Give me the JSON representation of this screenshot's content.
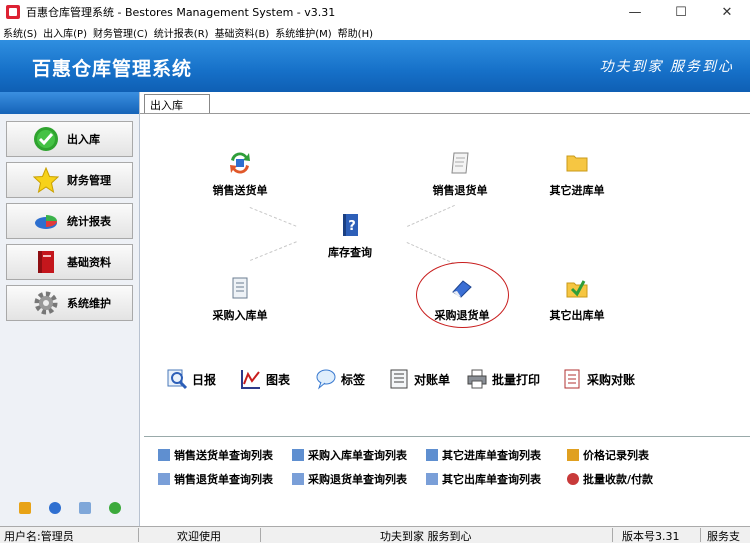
{
  "window": {
    "title": "百惠仓库管理系统 - Bestores Management System - v3.31",
    "minimize": "—",
    "maximize": "☐",
    "close": "✕"
  },
  "menu": [
    "系统(S)",
    "出入库(P)",
    "财务管理(C)",
    "统计报表(R)",
    "基础资料(B)",
    "系统维护(M)",
    "帮助(H)"
  ],
  "banner": {
    "brand": "百惠仓库管理系统",
    "slogan": "功夫到家 服务到心"
  },
  "nav": [
    {
      "label": "出入库",
      "icon": "check-circle-icon"
    },
    {
      "label": "财务管理",
      "icon": "star-icon"
    },
    {
      "label": "统计报表",
      "icon": "pie-chart-icon"
    },
    {
      "label": "基础资料",
      "icon": "book-icon"
    },
    {
      "label": "系统维护",
      "icon": "gear-icon"
    }
  ],
  "tab": {
    "label": "出入库"
  },
  "flow": {
    "sales_delivery": "销售送货单",
    "sales_return": "销售退货单",
    "other_in": "其它进库单",
    "inventory_query": "库存查询",
    "purchase_in": "采购入库单",
    "purchase_return": "采购退货单",
    "other_out": "其它出库单"
  },
  "tools": [
    "日报",
    "图表",
    "标签",
    "对账单",
    "批量打印",
    "采购对账"
  ],
  "links": [
    "销售送货单查询列表",
    "采购入库单查询列表",
    "其它进库单查询列表",
    "价格记录列表",
    "销售退货单查询列表",
    "采购退货单查询列表",
    "其它出库单查询列表",
    "批量收款/付款"
  ],
  "status": {
    "user": "用户名:管理员",
    "welcome": "欢迎使用",
    "slogan": "功夫到家 服务到心",
    "version": "版本号3.31",
    "service": "服务支"
  },
  "colors": {
    "banner": "#1670c8",
    "highlight_circle": "#c81e1e"
  }
}
